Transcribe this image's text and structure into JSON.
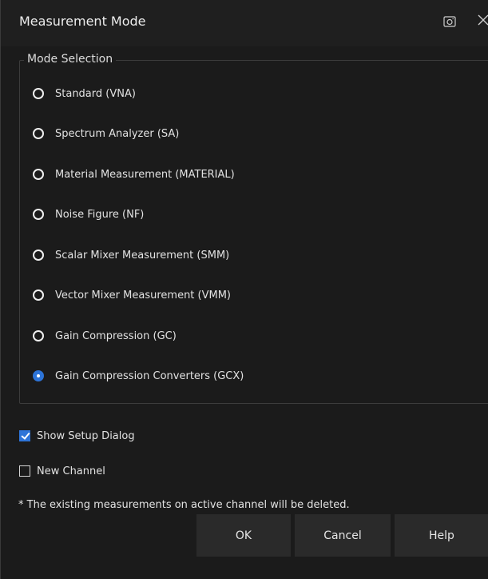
{
  "window": {
    "title": "Measurement Mode",
    "camera_icon": "camera-icon",
    "close_icon": "close-icon"
  },
  "mode_selection": {
    "title": "Mode Selection",
    "options": [
      {
        "label": "Standard  (VNA)",
        "selected": false
      },
      {
        "label": "Spectrum Analyzer  (SA)",
        "selected": false
      },
      {
        "label": "Material Measurement  (MATERIAL)",
        "selected": false
      },
      {
        "label": "Noise Figure  (NF)",
        "selected": false
      },
      {
        "label": "Scalar Mixer Measurement  (SMM)",
        "selected": false
      },
      {
        "label": "Vector Mixer Measurement (VMM)",
        "selected": false
      },
      {
        "label": "Gain Compression  (GC)",
        "selected": false
      },
      {
        "label": "Gain Compression Converters  (GCX)",
        "selected": true
      }
    ]
  },
  "options": {
    "show_setup_dialog": {
      "label": "Show Setup Dialog",
      "checked": true
    },
    "new_channel": {
      "label": "New Channel",
      "checked": false
    }
  },
  "note": "* The existing measurements on active channel will be deleted.",
  "buttons": {
    "ok": "OK",
    "cancel": "Cancel",
    "help": "Help"
  },
  "colors": {
    "background": "#1b1b1b",
    "accent": "#2d74d8",
    "button_bg": "#2a2a2a"
  }
}
